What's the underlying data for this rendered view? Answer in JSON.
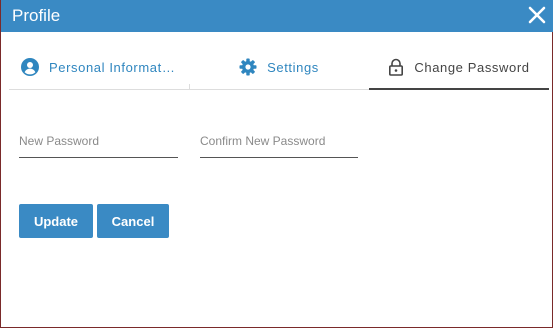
{
  "dialog": {
    "title": "Profile"
  },
  "tabs": [
    {
      "label": "Personal Information",
      "icon": "person-icon",
      "active": false
    },
    {
      "label": "Settings",
      "icon": "gear-icon",
      "active": false
    },
    {
      "label": "Change Password",
      "icon": "lock-icon",
      "active": true
    }
  ],
  "form": {
    "new_password": {
      "value": "",
      "placeholder": "New Password"
    },
    "confirm_password": {
      "value": "",
      "placeholder": "Confirm New Password"
    }
  },
  "buttons": {
    "update_label": "Update",
    "cancel_label": "Cancel"
  },
  "colors": {
    "titlebar": "#3a8ac4",
    "accent": "#2f86bf",
    "active_tab": "#444444",
    "button": "#3a8ac4"
  }
}
